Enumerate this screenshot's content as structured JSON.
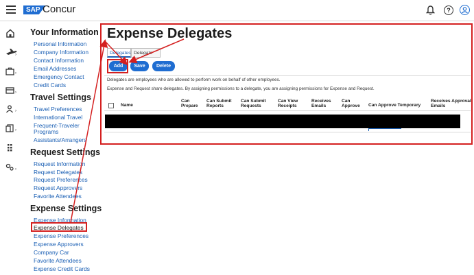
{
  "app": {
    "logo_text": "SAP",
    "brand_name": "Concur"
  },
  "icons": {
    "menu": "hamburger-menu-icon",
    "bell": "bell-icon",
    "help": "help-icon",
    "user": "user-icon",
    "help_glyph": "?"
  },
  "rail": [
    {
      "name": "home-icon"
    },
    {
      "name": "flight-icon"
    },
    {
      "name": "briefcase-icon"
    },
    {
      "name": "card-icon"
    },
    {
      "name": "people-icon"
    },
    {
      "name": "documents-icon"
    },
    {
      "name": "grid-icon"
    },
    {
      "name": "settings-icon"
    }
  ],
  "sidebar": {
    "your_information": {
      "heading": "Your Information",
      "items": [
        "Personal Information",
        "Company Information",
        "Contact Information",
        "Email Addresses",
        "Emergency Contact",
        "Credit Cards"
      ]
    },
    "travel_settings": {
      "heading": "Travel Settings",
      "items": [
        "Travel Preferences",
        "International Travel",
        "Frequent-Traveler",
        "Programs",
        "Assistants/Arrangers"
      ]
    },
    "request_settings": {
      "heading": "Request Settings",
      "items": [
        "Request Information",
        "Request Delegates",
        "Request Preferences",
        "Request Approvers",
        "Favorite Attendees"
      ]
    },
    "expense_settings": {
      "heading": "Expense Settings",
      "items": [
        "Expense Information",
        "Expense Delegates",
        "Expense Preferences",
        "Expense Approvers",
        "Company Car",
        "Favorite Attendees",
        "Expense Credit Cards"
      ]
    }
  },
  "main": {
    "title": "Expense Delegates",
    "tabs": [
      "Delegates",
      "Delegate For"
    ],
    "buttons": {
      "add": "Add",
      "save": "Save",
      "delete": "Delete"
    },
    "description_1": "Delegates are employees who are allowed to perform work on behalf of other employees.",
    "description_2": "Expense and Request share delegates. By assigning permissions to a delegate, you are assigning permissions for Expense and Request.",
    "columns": {
      "name": "Name",
      "can_prepare_1": "Can",
      "can_prepare_2": "Prepare",
      "can_submit_reports_1": "Can Submit",
      "can_submit_reports_2": "Reports",
      "can_submit_requests_1": "Can Submit",
      "can_submit_requests_2": "Requests",
      "can_view_receipts_1": "Can View",
      "can_view_receipts_2": "Receipts",
      "receives_emails_1": "Receives",
      "receives_emails_2": "Emails",
      "can_approve_1": "Can",
      "can_approve_2": "Approve",
      "can_approve_temporary": "Can Approve Temporary",
      "receives_approval_emails_1": "Receives Approval",
      "receives_approval_emails_2": "Emails"
    }
  },
  "colors": {
    "accent": "#1f6dd1",
    "link": "#1a5fb4",
    "annotation": "#d41f1f"
  }
}
